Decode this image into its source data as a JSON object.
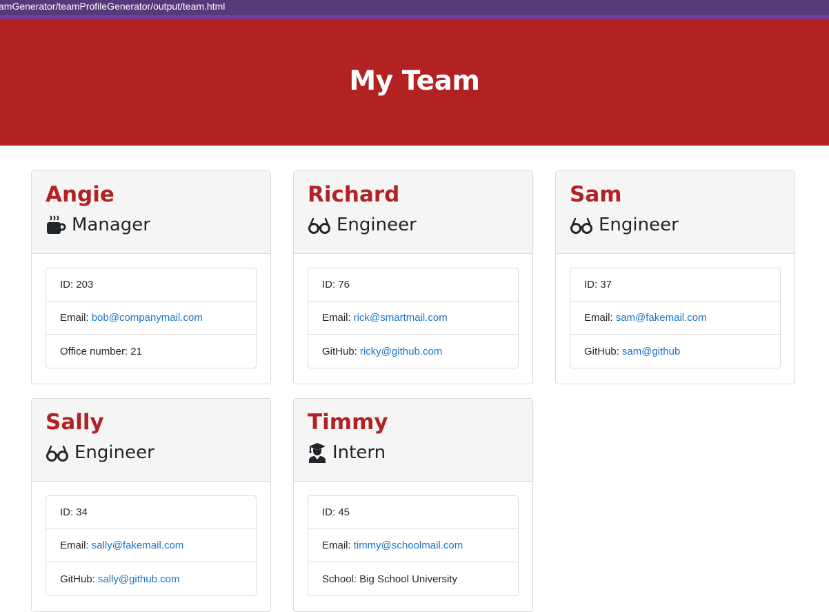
{
  "address_bar": {
    "url_text": "amGenerator/teamProfileGenerator/output/team.html"
  },
  "header": {
    "title": "My Team"
  },
  "colors": {
    "hero_bg": "#b22222",
    "name_color": "#b22222",
    "link_color": "#1a73c8"
  },
  "employees": [
    {
      "name": "Angie",
      "role": "Manager",
      "role_icon": "coffee-mug-icon",
      "id_label": "ID:",
      "id": "203",
      "email_label": "Email:",
      "email": "bob@companymail.com",
      "extra_label": "Office number:",
      "extra": "21"
    },
    {
      "name": "Richard",
      "role": "Engineer",
      "role_icon": "glasses-icon",
      "id_label": "ID:",
      "id": "76",
      "email_label": "Email:",
      "email": "rick@smartmail.com",
      "extra_label": "GitHub:",
      "extra": "ricky@github.com"
    },
    {
      "name": "Sam",
      "role": "Engineer",
      "role_icon": "glasses-icon",
      "id_label": "ID:",
      "id": "37",
      "email_label": "Email:",
      "email": "sam@fakemail.com",
      "extra_label": "GitHub:",
      "extra": "sam@github"
    },
    {
      "name": "Sally",
      "role": "Engineer",
      "role_icon": "glasses-icon",
      "id_label": "ID:",
      "id": "34",
      "email_label": "Email:",
      "email": "sally@fakemail.com",
      "extra_label": "GitHub:",
      "extra": "sally@github.com"
    },
    {
      "name": "Timmy",
      "role": "Intern",
      "role_icon": "graduate-icon",
      "id_label": "ID:",
      "id": "45",
      "email_label": "Email:",
      "email": "timmy@schoolmail.com",
      "extra_label": "School:",
      "extra": "Big School University"
    }
  ]
}
